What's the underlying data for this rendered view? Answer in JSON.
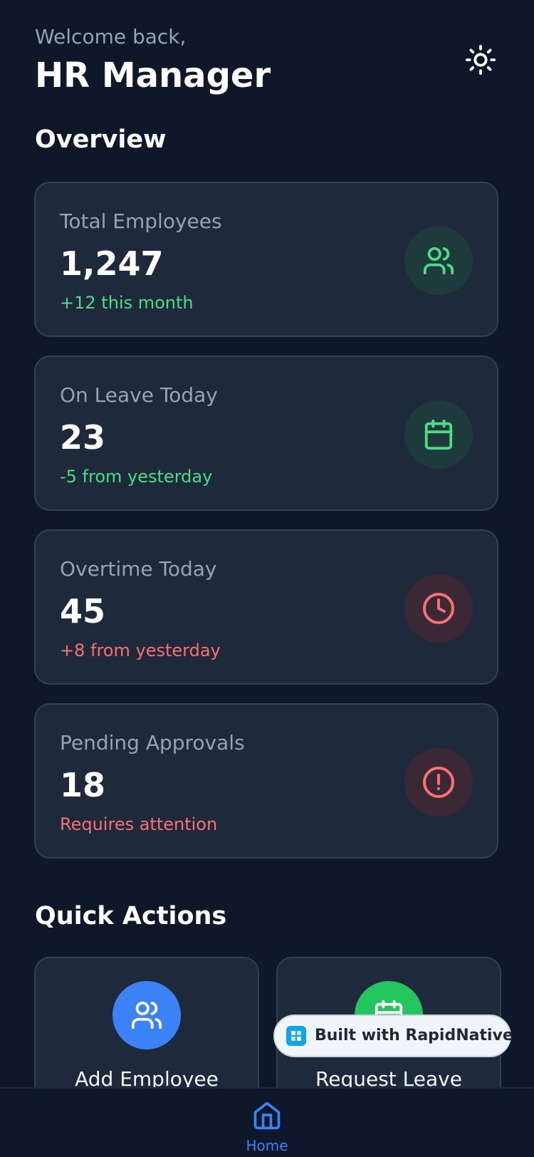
{
  "header": {
    "greeting": "Welcome back,",
    "user_name": "HR Manager",
    "theme_icon": "sun-icon"
  },
  "overview": {
    "title": "Overview",
    "cards": [
      {
        "label": "Total Employees",
        "value": "1,247",
        "delta": "+12 this month",
        "delta_color": "#4ade80",
        "icon": "users-icon",
        "icon_color": "#4ade80"
      },
      {
        "label": "On Leave Today",
        "value": "23",
        "delta": "-5 from yesterday",
        "delta_color": "#4ade80",
        "icon": "calendar-icon",
        "icon_color": "#4ade80"
      },
      {
        "label": "Overtime Today",
        "value": "45",
        "delta": "+8 from yesterday",
        "delta_color": "#f87171",
        "icon": "clock-icon",
        "icon_color": "#f87171"
      },
      {
        "label": "Pending Approvals",
        "value": "18",
        "delta": "Requires attention",
        "delta_color": "#f87171",
        "icon": "alert-circle-icon",
        "icon_color": "#f87171"
      }
    ]
  },
  "quick_actions": {
    "title": "Quick Actions",
    "items": [
      {
        "label": "Add Employee",
        "icon": "users-icon",
        "color": "#3b82f6"
      },
      {
        "label": "Request Leave",
        "icon": "calendar-icon",
        "color": "#22c55e"
      }
    ]
  },
  "badge": {
    "text": "Built with RapidNative"
  },
  "tab_bar": {
    "items": [
      {
        "label": "Home",
        "icon": "home-icon",
        "active": true,
        "color": "#3b82f6"
      }
    ]
  },
  "colors": {
    "background": "#0f172a",
    "card": "#1e293b",
    "card_border": "#334155",
    "muted_text": "#94a3b8",
    "positive": "#4ade80",
    "negative": "#f87171",
    "accent": "#3b82f6"
  }
}
